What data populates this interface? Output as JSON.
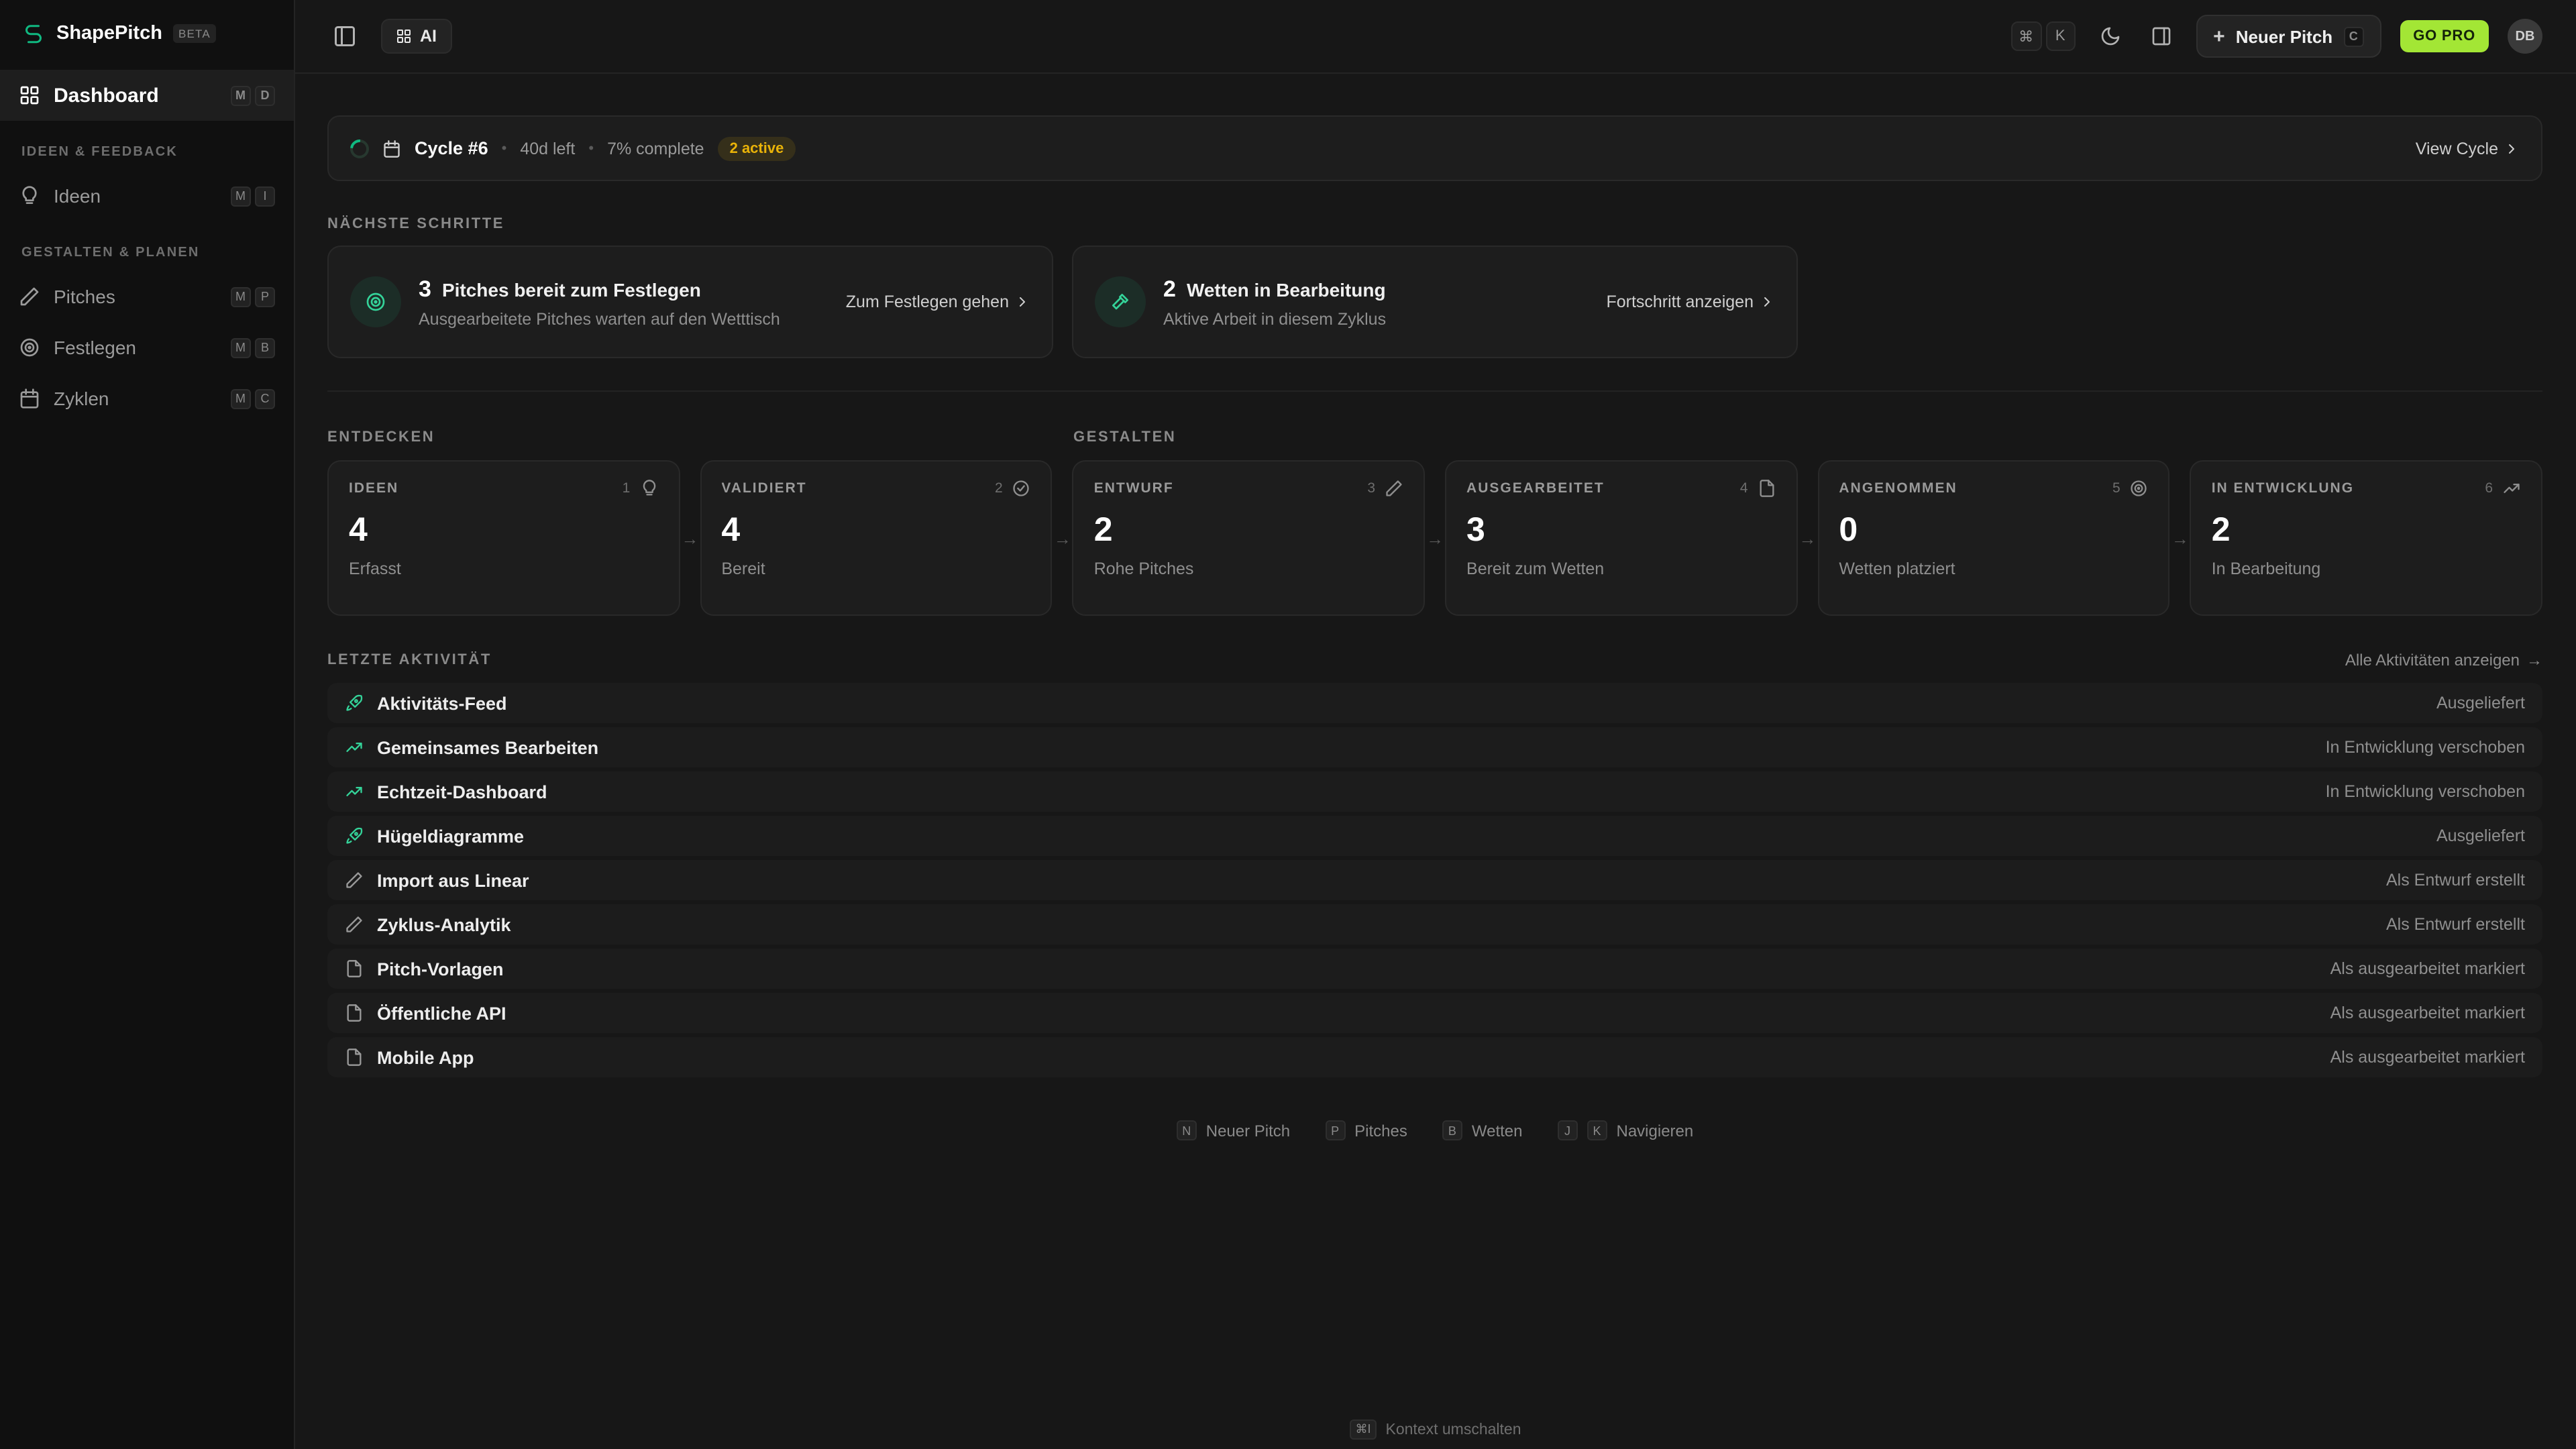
{
  "app": {
    "name": "ShapePitch",
    "beta": "BETA"
  },
  "sidebar": {
    "sections": [
      "IDEEN & FEEDBACK",
      "GESTALTEN & PLANEN"
    ],
    "items": [
      {
        "label": "Dashboard",
        "keys": [
          "M",
          "D"
        ]
      },
      {
        "label": "Ideen",
        "keys": [
          "M",
          "I"
        ]
      },
      {
        "label": "Pitches",
        "keys": [
          "M",
          "P"
        ]
      },
      {
        "label": "Festlegen",
        "keys": [
          "M",
          "B"
        ]
      },
      {
        "label": "Zyklen",
        "keys": [
          "M",
          "C"
        ]
      }
    ]
  },
  "topbar": {
    "ai_label": "AI",
    "cmd_key": "⌘",
    "k_key": "K",
    "new_pitch_label": "Neuer Pitch",
    "new_pitch_plus": "+",
    "new_pitch_key": "C",
    "go_pro_label": "GO PRO",
    "avatar_initials": "DB"
  },
  "cycle_banner": {
    "title": "Cycle #6",
    "sep": "•",
    "days_left": "40d left",
    "complete": "7% complete",
    "active_badge": "2 active",
    "view_link": "View Cycle"
  },
  "next_steps": {
    "heading": "NÄCHSTE SCHRITTE",
    "cards": [
      {
        "count": "3",
        "title": "Pitches bereit zum Festlegen",
        "subtitle": "Ausgearbeitete Pitches warten auf den Wetttisch",
        "action": "Zum Festlegen gehen"
      },
      {
        "count": "2",
        "title": "Wetten in Bearbeitung",
        "subtitle": "Aktive Arbeit in diesem Zyklus",
        "action": "Fortschritt anzeigen"
      }
    ]
  },
  "pipeline": {
    "group_headings": [
      "ENTDECKEN",
      "GESTALTEN"
    ],
    "arrow": "→",
    "cards": [
      {
        "label": "IDEEN",
        "index": "1",
        "value": "4",
        "sublabel": "Erfasst"
      },
      {
        "label": "VALIDIERT",
        "index": "2",
        "value": "4",
        "sublabel": "Bereit"
      },
      {
        "label": "ENTWURF",
        "index": "3",
        "value": "2",
        "sublabel": "Rohe Pitches"
      },
      {
        "label": "AUSGEARBEITET",
        "index": "4",
        "value": "3",
        "sublabel": "Bereit zum Wetten"
      },
      {
        "label": "ANGENOMMEN",
        "index": "5",
        "value": "0",
        "sublabel": "Wetten platziert"
      },
      {
        "label": "IN ENTWICKLUNG",
        "index": "6",
        "value": "2",
        "sublabel": "In Bearbeitung"
      }
    ]
  },
  "activity": {
    "heading": "LETZTE AKTIVITÄT",
    "view_all": "Alle Aktivitäten anzeigen",
    "view_all_arrow": "→",
    "rows": [
      {
        "title": "Aktivitäts-Feed",
        "status": "Ausgeliefert"
      },
      {
        "title": "Gemeinsames Bearbeiten",
        "status": "In Entwicklung verschoben"
      },
      {
        "title": "Echtzeit-Dashboard",
        "status": "In Entwicklung verschoben"
      },
      {
        "title": "Hügeldiagramme",
        "status": "Ausgeliefert"
      },
      {
        "title": "Import aus Linear",
        "status": "Als Entwurf erstellt"
      },
      {
        "title": "Zyklus-Analytik",
        "status": "Als Entwurf erstellt"
      },
      {
        "title": "Pitch-Vorlagen",
        "status": "Als ausgearbeitet markiert"
      },
      {
        "title": "Öffentliche API",
        "status": "Als ausgearbeitet markiert"
      },
      {
        "title": "Mobile App",
        "status": "Als ausgearbeitet markiert"
      }
    ]
  },
  "footer_hints": [
    {
      "keys": [
        "N"
      ],
      "label": "Neuer Pitch"
    },
    {
      "keys": [
        "P"
      ],
      "label": "Pitches"
    },
    {
      "keys": [
        "B"
      ],
      "label": "Wetten"
    },
    {
      "keys": [
        "J",
        "K"
      ],
      "label": "Navigieren"
    }
  ],
  "bottom_hint": {
    "key": "⌘I",
    "label": "Kontext umschalten"
  }
}
